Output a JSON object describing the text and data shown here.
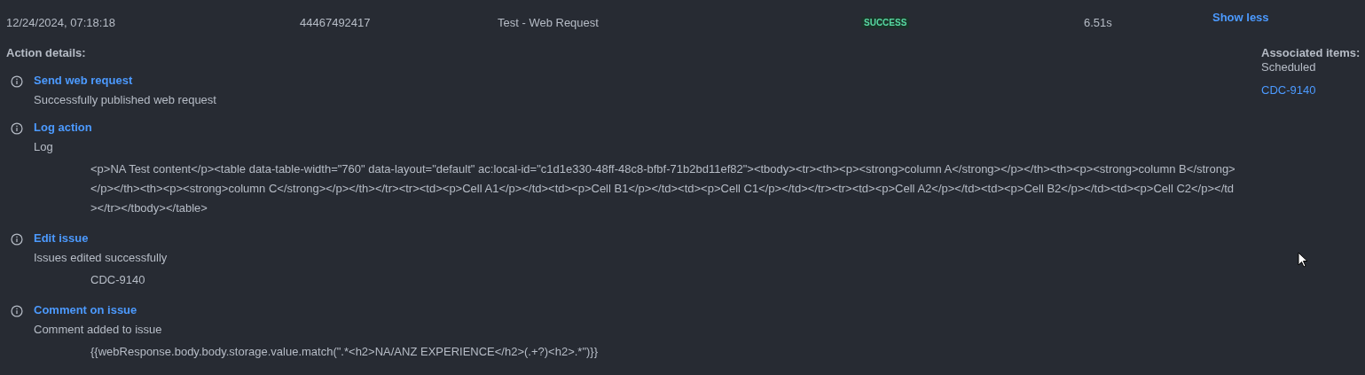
{
  "row": {
    "date": "12/24/2024, 07:18:18",
    "id": "44467492417",
    "rule": "Test - Web Request",
    "status": {
      "label": "SUCCESS",
      "kind": "success"
    },
    "duration": "6.51s",
    "toggle": "Show less"
  },
  "details": {
    "heading": "Action details:",
    "actions": [
      {
        "title": "Send web request",
        "message": "Successfully published web request"
      },
      {
        "title": "Log action",
        "message": "Log",
        "detail": "<p>NA Test content</p><table data-table-width=\"760\" data-layout=\"default\" ac:local-id=\"c1d1e330-48ff-48c8-bfbf-71b2bd11ef82\"><tbody><tr><th><p><strong>column A</strong></p></th><th><p><strong>column B</strong></p></th><th><p><strong>column C</strong></p></th></tr><tr><td><p>Cell A1</p></td><td><p>Cell B1</p></td><td><p>Cell C1</p></td></tr><tr><td><p>Cell A2</p></td><td><p>Cell B2</p></td><td><p>Cell C2</p></td></tr></tbody></table>"
      },
      {
        "title": "Edit issue",
        "message": "Issues edited successfully",
        "detail": "CDC-9140"
      },
      {
        "title": "Comment on issue",
        "message": "Comment added to issue",
        "detail": "{{webResponse.body.body.storage.value.match(\".*<h2>NA/ANZ EXPERIENCE</h2>(.+?)<h2>.*\")}}"
      }
    ]
  },
  "associated": {
    "heading": "Associated items:",
    "label": "Scheduled",
    "items": [
      "CDC-9140"
    ]
  }
}
